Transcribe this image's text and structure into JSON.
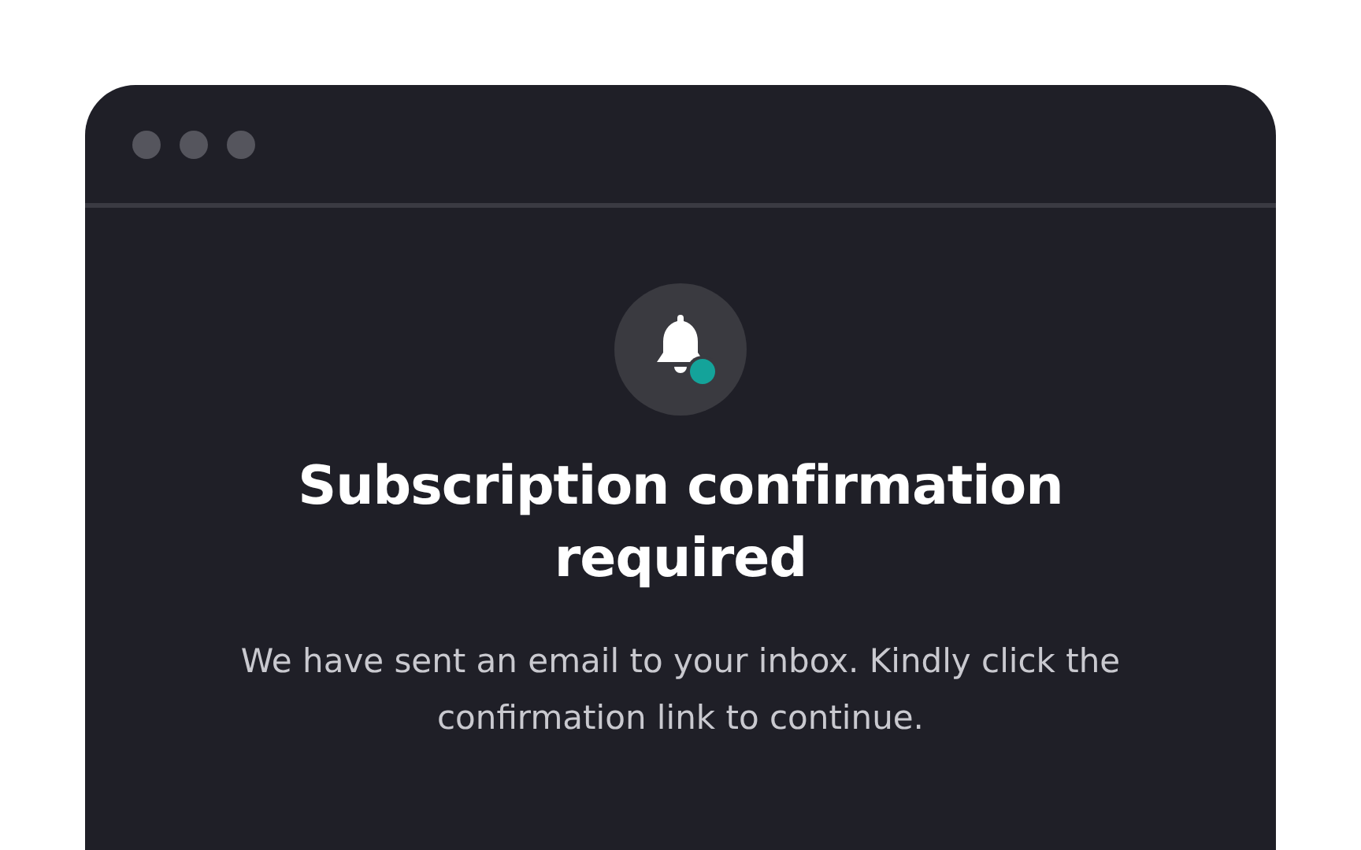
{
  "dialog": {
    "heading": "Subscription confirmation required",
    "message": "We have sent an email to your inbox. Kindly click the confirmation link to continue."
  }
}
